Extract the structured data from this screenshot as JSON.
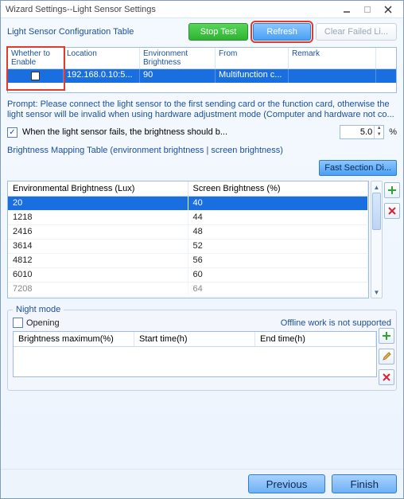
{
  "window": {
    "title": "Wizard Settings--Light Sensor Settings"
  },
  "top": {
    "label": "Light Sensor Configuration Table",
    "stop_test": "Stop Test",
    "refresh": "Refresh",
    "clear_failed": "Clear Failed Li..."
  },
  "config_cols": {
    "enable": "Whether to Enable",
    "location": "Location",
    "env": "Environment Brightness",
    "from": "From",
    "remark": "Remark"
  },
  "config_rows": [
    {
      "enable": false,
      "location": "192.168.0.10:5...",
      "env": "90",
      "from": "Multifunction c...",
      "remark": ""
    }
  ],
  "prompt": "Prompt: Please connect the light sensor to the first sending card or the function card, otherwise the light sensor will be invalid when using hardware adjustment mode (Computer and hardware not co...",
  "fail_checkbox": {
    "checked": true,
    "label": "When the light sensor fails, the brightness should b...",
    "value": "5.0",
    "unit": "%"
  },
  "map_section": "Brightness Mapping Table (environment brightness | screen brightness)",
  "fast_section": "Fast Section Di...",
  "map_cols": {
    "env": "Environmental Brightness (Lux)",
    "screen": "Screen Brightness (%)"
  },
  "map_rows": [
    {
      "env": "20",
      "screen": "40",
      "sel": true
    },
    {
      "env": "1218",
      "screen": "44"
    },
    {
      "env": "2416",
      "screen": "48"
    },
    {
      "env": "3614",
      "screen": "52"
    },
    {
      "env": "4812",
      "screen": "56"
    },
    {
      "env": "6010",
      "screen": "60"
    },
    {
      "env": "7208",
      "screen": "64",
      "last": true
    }
  ],
  "night": {
    "legend": "Night mode",
    "opening_label": "Opening",
    "opening_checked": false,
    "offline": "Offline work is not supported",
    "cols": {
      "max": "Brightness maximum(%)",
      "start": "Start time(h)",
      "end": "End time(h)"
    }
  },
  "footer": {
    "previous": "Previous",
    "finish": "Finish"
  }
}
